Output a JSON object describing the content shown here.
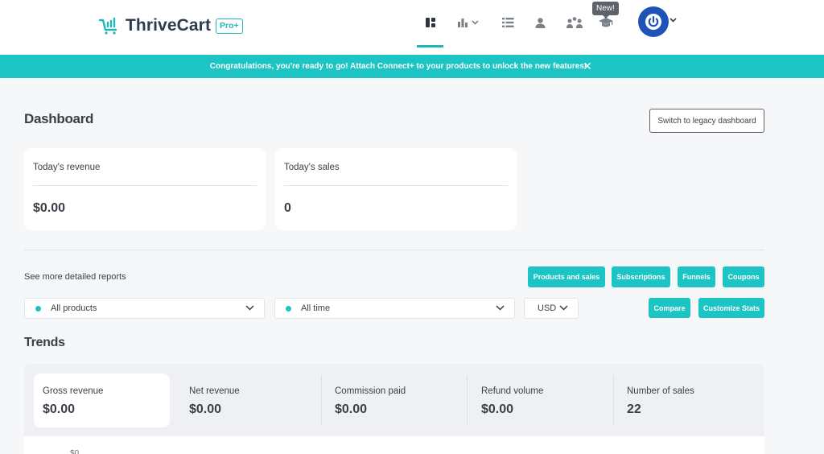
{
  "header": {
    "brand": "ThriveCart",
    "plan_badge": "Pro+",
    "new_badge": "New!",
    "nav_icons": [
      "dashboard-icon",
      "reports-chart-icon",
      "list-icon",
      "user-icon",
      "affiliates-icon",
      "learn-icon"
    ]
  },
  "banner": {
    "message": "Congratulations, you're ready to go!  Attach Connect+ to your products to unlock the new features!",
    "close": "✕"
  },
  "dashboard": {
    "title": "Dashboard",
    "legacy_button": "Switch to legacy dashboard",
    "cards": [
      {
        "label": "Today's revenue",
        "value": "$0.00"
      },
      {
        "label": "Today's sales",
        "value": "0"
      }
    ]
  },
  "reports": {
    "label": "See more detailed reports",
    "buttons": [
      "Products and sales",
      "Subscriptions",
      "Funnels",
      "Coupons"
    ],
    "filters": {
      "products": "All products",
      "timeframe": "All time",
      "currency": "USD"
    },
    "actions": [
      "Compare",
      "Customize Stats"
    ]
  },
  "trends": {
    "title": "Trends",
    "metrics": [
      {
        "label": "Gross revenue",
        "value": "$0.00"
      },
      {
        "label": "Net revenue",
        "value": "$0.00"
      },
      {
        "label": "Commission paid",
        "value": "$0.00"
      },
      {
        "label": "Refund volume",
        "value": "$0.00"
      },
      {
        "label": "Number of sales",
        "value": "22"
      }
    ],
    "axis_first_label": "$0"
  },
  "colors": {
    "accent": "#1cc4c4",
    "brand_teal": "#1db9b8",
    "avatar": "#1f53b8",
    "text": "#3a3f47"
  }
}
